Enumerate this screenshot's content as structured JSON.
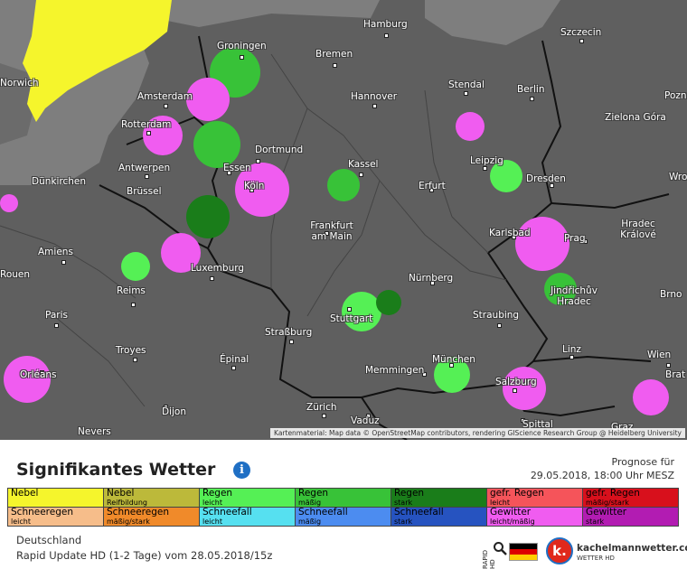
{
  "map": {
    "attribution": "Kartenmaterial: Map data © OpenStreetMap contributors, rendering GIScience Research Group @ Heidelberg University",
    "cities": [
      "Groningen",
      "Hamburg",
      "Szczecin",
      "Bremen",
      "Norwich",
      "Amsterdam",
      "Hannover",
      "Stendal",
      "Berlin",
      "Poznań",
      "Rotterdam",
      "Dortmund",
      "Zielona Góra",
      "Antwerpen",
      "Essen",
      "Kassel",
      "Leipzig",
      "Dünkirchen",
      "Brüssel",
      "Köln",
      "Erfurt",
      "Dresden",
      "Wrocław",
      "Hradec Králové",
      "Frankfurt am Main",
      "Karlsbad",
      "Prag",
      "Amiens",
      "Luxemburg",
      "Nürnberg",
      "Jindřichův Hradec",
      "Brno",
      "Reims",
      "Paris",
      "Stuttgart",
      "Straubing",
      "Troyes",
      "Straßburg",
      "Linz",
      "Épinal",
      "München",
      "Wien",
      "Memmingen",
      "Orléans",
      "Salzburg",
      "Brat",
      "Dijon",
      "Zürich",
      "Vaduz",
      "Spittal",
      "Nevers",
      "Graz",
      "Rouen"
    ]
  },
  "panel": {
    "title": "Signifikantes Wetter",
    "forecast_label": "Prognose für",
    "forecast_time": "29.05.2018, 18:00 Uhr MESZ",
    "region": "Deutschland",
    "model_run": "Rapid Update HD (1-2 Tage) vom 28.05.2018/15z",
    "brand": "kachelmannwetter.com",
    "brand_sub": "WETTER HD",
    "radar_label": "RAPID HD"
  },
  "legend": [
    [
      {
        "label": "Nebel",
        "sub": "",
        "color": "#f5f52c"
      },
      {
        "label": "Nebel",
        "sub": "Reifbildung",
        "color": "#bcb93a"
      },
      {
        "label": "Regen",
        "sub": "leicht",
        "color": "#55f055"
      },
      {
        "label": "Regen",
        "sub": "mäßig",
        "color": "#38c238"
      },
      {
        "label": "Regen",
        "sub": "stark",
        "color": "#1a7d1a"
      },
      {
        "label": "gefr. Regen",
        "sub": "leicht",
        "color": "#f5545a"
      },
      {
        "label": "gefr. Regen",
        "sub": "mäßig/stark",
        "color": "#d8101c"
      }
    ],
    [
      {
        "label": "Schneeregen",
        "sub": "leicht",
        "color": "#f6bd8a"
      },
      {
        "label": "Schneeregen",
        "sub": "mäßig/stark",
        "color": "#f08a2a"
      },
      {
        "label": "Schneefall",
        "sub": "leicht",
        "color": "#56e0f0"
      },
      {
        "label": "Schneefall",
        "sub": "mäßig",
        "color": "#4c8cf0"
      },
      {
        "label": "Schneefall",
        "sub": "stark",
        "color": "#2653c0"
      },
      {
        "label": "Gewitter",
        "sub": "leicht/mäßig",
        "color": "#f05cf0"
      },
      {
        "label": "Gewitter",
        "sub": "stark",
        "color": "#b21cb2"
      }
    ]
  ]
}
